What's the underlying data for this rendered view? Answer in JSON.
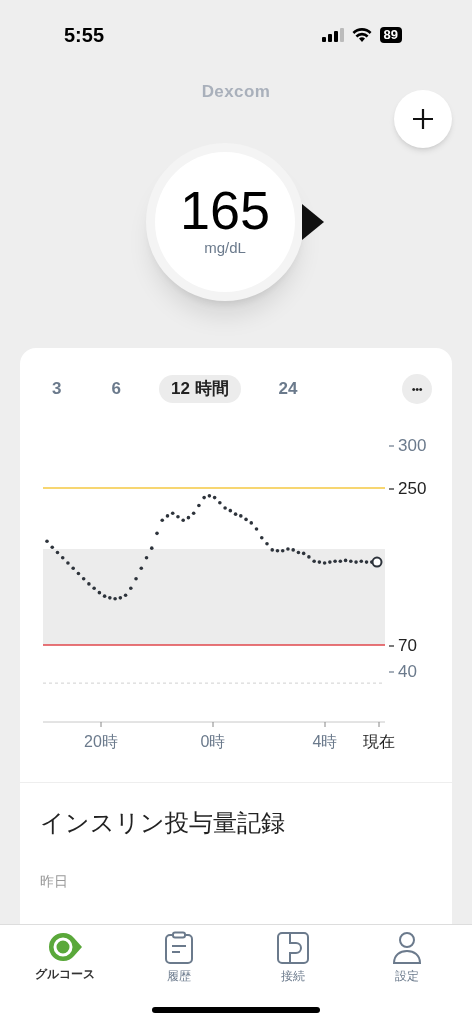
{
  "status_bar": {
    "time": "5:55",
    "battery": "89"
  },
  "brand": "Dexcom",
  "reading": {
    "value": "165",
    "unit": "mg/dL"
  },
  "range_tabs": [
    {
      "label": "3",
      "selected": false
    },
    {
      "label": "6",
      "selected": false
    },
    {
      "label": "12 時間",
      "selected": true
    },
    {
      "label": "24",
      "selected": false
    }
  ],
  "more_button": "•••",
  "chart": {
    "y_labels": [
      "300",
      "250",
      "70",
      "40"
    ],
    "x_labels": [
      "20時",
      "0時",
      "4時",
      "現在"
    ]
  },
  "insulin": {
    "title": "インスリン投与量記録",
    "date": "昨日"
  },
  "tab_bar": [
    {
      "label": "グルコース",
      "selected": true
    },
    {
      "label": "履歴",
      "selected": false
    },
    {
      "label": "接続",
      "selected": false
    },
    {
      "label": "設定",
      "selected": false
    }
  ]
}
